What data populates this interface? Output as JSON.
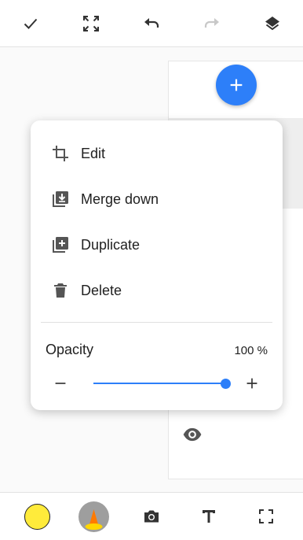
{
  "top_toolbar": {
    "icons": [
      "check-icon",
      "fit-screen-icon",
      "undo-icon",
      "redo-icon",
      "layers-icon"
    ],
    "disabled_color": "#c8c8c8"
  },
  "layer_panel": {
    "add_icon": "plus-icon",
    "visibility_icon": "eye-icon",
    "accent": "#2d7ff9"
  },
  "menu": {
    "items": [
      {
        "label": "Edit",
        "icon": "crop-icon"
      },
      {
        "label": "Merge down",
        "icon": "merge-down-icon"
      },
      {
        "label": "Duplicate",
        "icon": "duplicate-icon"
      },
      {
        "label": "Delete",
        "icon": "trash-icon"
      }
    ],
    "opacity": {
      "label": "Opacity",
      "value_text": "100 %",
      "value": 1.0
    }
  },
  "bottom_toolbar": {
    "color": "#ffeb3b",
    "brush_colors": [
      "#ff7a00",
      "#ffd600"
    ],
    "icons": [
      "color-swatch",
      "brush-icon",
      "camera-icon",
      "text-icon",
      "fullscreen-icon"
    ]
  }
}
